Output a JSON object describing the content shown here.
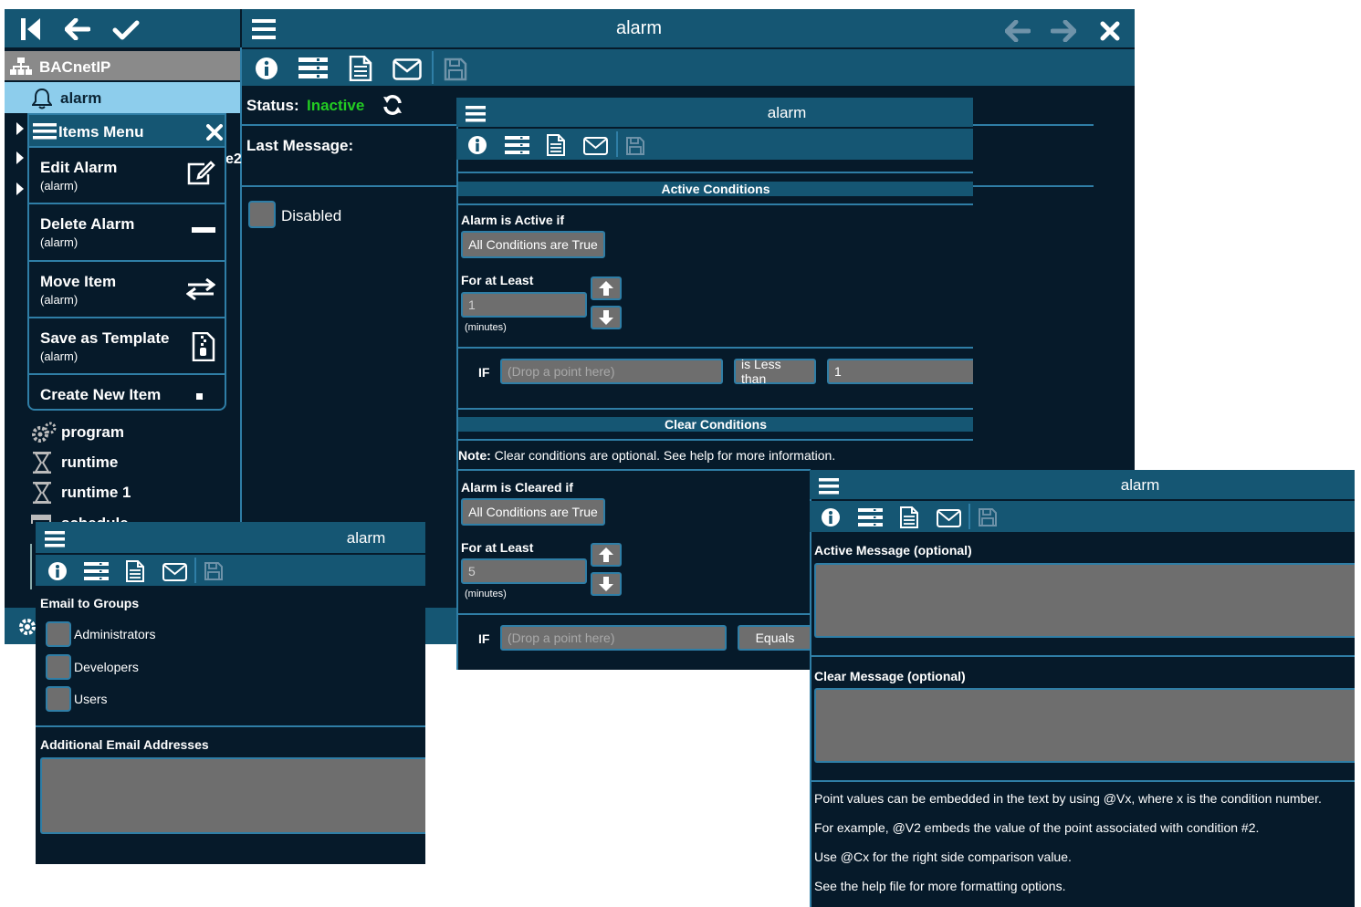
{
  "main_window": {
    "title": "alarm",
    "status_label": "Status:",
    "status_value": "Inactive",
    "status_color": "#22cc22",
    "last_message_label": "Last Message:",
    "disabled_label": "Disabled"
  },
  "tree": {
    "root": "BACnetIP",
    "selected": "alarm",
    "truncated_suffix": "e2",
    "items": [
      {
        "label": "program",
        "icon": "gears-icon"
      },
      {
        "label": "runtime",
        "icon": "hourglass-icon"
      },
      {
        "label": "runtime 1",
        "icon": "hourglass-icon"
      },
      {
        "label": "schedule",
        "icon": "calendar-icon"
      }
    ]
  },
  "items_menu": {
    "title": "Items Menu",
    "items": [
      {
        "title": "Edit Alarm",
        "sub": "(alarm)",
        "icon": "edit-icon"
      },
      {
        "title": "Delete Alarm",
        "sub": "(alarm)",
        "icon": "minus-icon"
      },
      {
        "title": "Move Item",
        "sub": "(alarm)",
        "icon": "move-icon"
      },
      {
        "title": "Save as Template",
        "sub": "(alarm)",
        "icon": "zip-file-icon"
      },
      {
        "title": "Create New Item",
        "sub": "",
        "icon": "square-icon"
      }
    ]
  },
  "conditions_window": {
    "title": "alarm",
    "active_header": "Active Conditions",
    "alarm_active_if": "Alarm is Active if",
    "active_mode": "All Conditions are True",
    "for_at_least": "For at Least",
    "active_minutes_value": "1",
    "minutes_unit": "(minutes)",
    "if_label": "IF",
    "drop_placeholder": "(Drop a point here)",
    "active_comparator": "is Less than",
    "active_compare_value": "1",
    "clear_header": "Clear Conditions",
    "note_label": "Note:",
    "note_text": " Clear conditions are optional. See help for more information.",
    "alarm_cleared_if": "Alarm is Cleared if",
    "clear_mode": "All Conditions are True",
    "clear_minutes_value": "5",
    "clear_comparator": "Equals"
  },
  "email_window": {
    "title": "alarm",
    "groups_label": "Email to Groups",
    "groups": [
      "Administrators",
      "Developers",
      "Users"
    ],
    "additional_label": "Additional Email Addresses"
  },
  "message_window": {
    "title": "alarm",
    "active_message_label": "Active Message (optional)",
    "clear_message_label": "Clear Message (optional)",
    "help_lines": [
      "Point values can be embedded in the text by using @Vx, where x is the condition number.",
      "For example, @V2 embeds the value of the point associated with condition #2.",
      "Use @Cx for the right side comparison value.",
      "See the help file for more formatting options."
    ]
  }
}
